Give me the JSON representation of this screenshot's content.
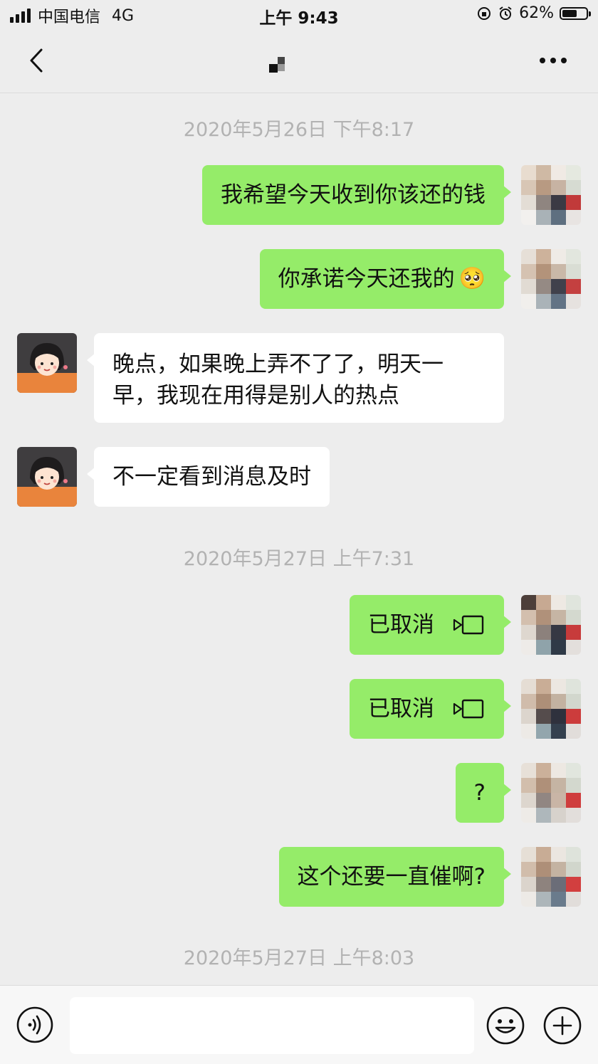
{
  "status_bar": {
    "carrier": "中国电信",
    "network": "4G",
    "time": "上午 9:43",
    "battery_text": "62%",
    "battery_level": 0.62
  },
  "nav": {
    "back_icon": "chevron-left-icon",
    "more_icon": "more-dots-icon"
  },
  "chat": {
    "ts1": "2020年5月26日 下午8:17",
    "msg1": "我希望今天收到你该还的钱",
    "msg2": "你承诺今天还我的",
    "msg2_emoji": "🥺",
    "msg3_line1": "晚点，如果晚上弄不了了，明天一",
    "msg3_line2": "早，我现在用得是别人的热点",
    "msg4": "不一定看到消息及时",
    "ts2": "2020年5月27日 上午7:31",
    "msg5": "已取消",
    "msg6": "已取消",
    "msg7": "?",
    "msg8": "这个还要一直催啊?",
    "ts3": "2020年5月27日 上午8:03"
  },
  "colors": {
    "background": "#ededed",
    "outgoing_bubble": "#95ec69",
    "incoming_bubble": "#ffffff",
    "timestamp_text": "#b2b2b2"
  },
  "input_bar": {
    "voice_icon": "voice-icon",
    "emoji_icon": "emoji-icon",
    "plus_icon": "plus-icon",
    "text_value": ""
  }
}
